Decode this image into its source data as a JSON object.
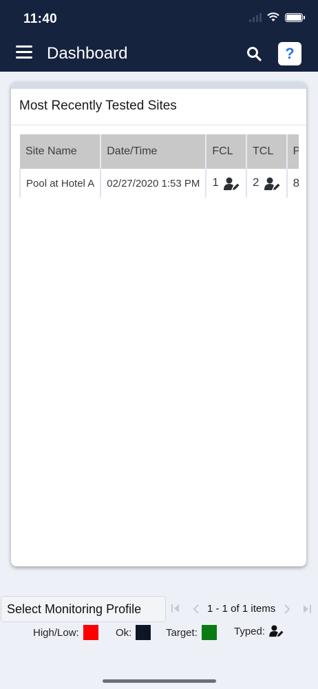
{
  "status_bar": {
    "time": "11:40"
  },
  "header": {
    "title": "Dashboard",
    "help_label": "?"
  },
  "card": {
    "title": "Most Recently Tested Sites",
    "table": {
      "columns": [
        "Site Name",
        "Date/Time",
        "FCL",
        "TCL",
        "P"
      ],
      "rows": [
        {
          "site_name": "Pool at Hotel A",
          "datetime": "02/27/2020 1:53 PM",
          "fcl": "1",
          "tcl": "2",
          "p": "8"
        }
      ]
    }
  },
  "footer": {
    "profile_button": "Select Monitoring Profile",
    "pager_info": "1 - 1 of 1 items"
  },
  "legend": {
    "high_low_label": "High/Low:",
    "high_low_color": "#ff0000",
    "ok_label": "Ok:",
    "ok_color": "#0d1626",
    "target_label": "Target:",
    "target_color": "#0a7d12",
    "typed_label": "Typed:",
    "typed_icon": "user-edit-icon"
  },
  "colors": {
    "header_bg": "#15233f",
    "accent": "#2f6ff0"
  }
}
